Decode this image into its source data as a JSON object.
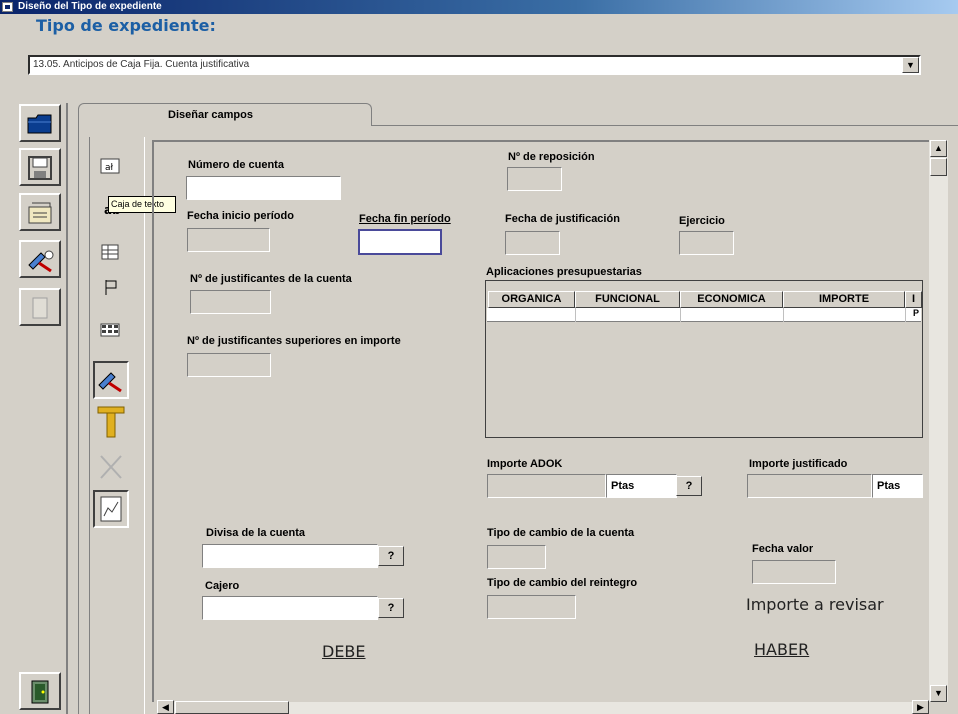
{
  "window": {
    "title": "Diseño del Tipo de expediente"
  },
  "header": {
    "type_label": "Tipo de expediente:",
    "type_value": "13.05. Anticipos de Caja Fija. Cuenta justificativa"
  },
  "tabs": [
    {
      "label": "Diseñar campos",
      "active": true
    }
  ],
  "palette": {
    "tooltip": "Caja de texto"
  },
  "form": {
    "numero_cuenta": "Número de cuenta",
    "numero_reposicion": "Nº de reposición",
    "fecha_inicio": "Fecha inicio período",
    "fecha_fin": "Fecha fin período",
    "fecha_justificacion": "Fecha de justificación",
    "ejercicio": "Ejercicio",
    "num_justificantes": "Nº de justificantes de la cuenta",
    "num_justificantes_sup": "Nº de justificantes superiores en importe",
    "aplicaciones": "Aplicaciones presupuestarias",
    "grid_columns": [
      "ORGANICA",
      "FUNCIONAL",
      "ECONOMICA",
      "IMPORTE",
      "I"
    ],
    "grid_row_marker": "P",
    "importe_adok": "Importe ADOK",
    "importe_justificado": "Importe justificado",
    "currency": "Ptas",
    "help_button": "?",
    "divisa_cuenta": "Divisa de la cuenta",
    "cajero": "Cajero",
    "tipo_cambio_cuenta": "Tipo de cambio de la cuenta",
    "tipo_cambio_reintegro": "Tipo de cambio del reintegro",
    "fecha_valor": "Fecha valor",
    "importe_revisar": "Importe a revisar",
    "debe": "DEBE",
    "haber": "HABER"
  }
}
